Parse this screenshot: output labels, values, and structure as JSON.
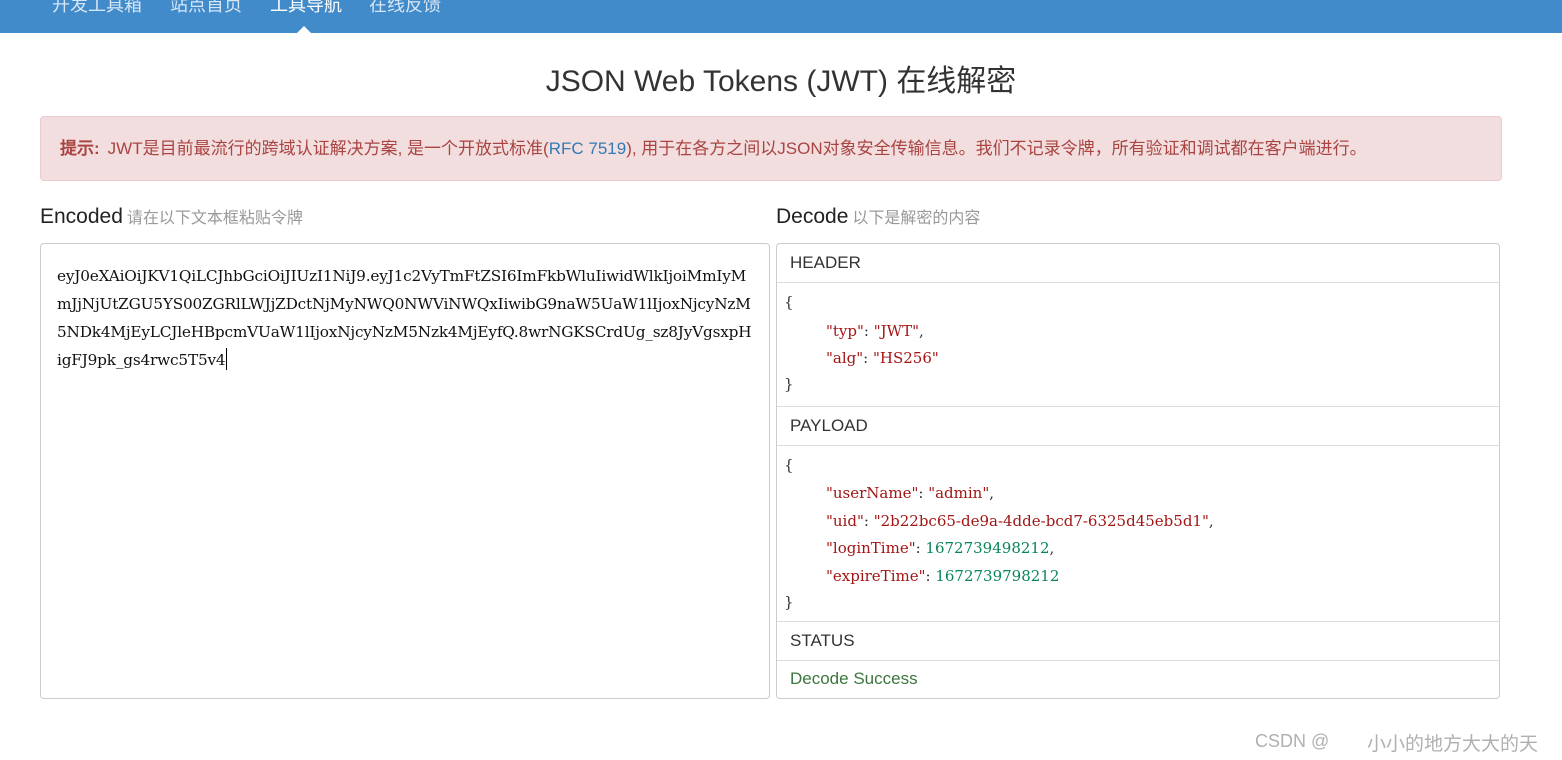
{
  "nav": {
    "items": [
      {
        "label": "开发工具箱"
      },
      {
        "label": "站点首页"
      },
      {
        "label": "工具导航"
      },
      {
        "label": "在线反馈"
      }
    ]
  },
  "page": {
    "title": "JSON Web Tokens (JWT) 在线解密"
  },
  "alert": {
    "label": "提示:",
    "text_before": "JWT是目前最流行的跨域认证解决方案, 是一个开放式标准(",
    "link": "RFC 7519",
    "text_after": "), 用于在各方之间以JSON对象安全传输信息。我们不记录令牌，所有验证和调试都在客户端进行。"
  },
  "encoded": {
    "heading": "Encoded",
    "sub": "请在以下文本框粘贴令牌",
    "token": "eyJ0eXAiOiJKV1QiLCJhbGciOiJIUzI1NiJ9.eyJ1c2VyTmFtZSI6ImFkbWluIiwidWlkIjoiMmIyMmJjNjUtZGU5YS00ZGRlLWJjZDctNjMyNWQ0NWViNWQxIiwibG9naW5UaW1lIjoxNjcyNzM5NDk4MjEyLCJleHBpcmVUaW1lIjoxNjcyNzM5Nzk4MjEyfQ.8wrNGKSCrdUg_sz8JyVgsxpHigFJ9pk_gs4rwc5T5v4"
  },
  "decode": {
    "heading": "Decode",
    "sub": "以下是解密的内容",
    "header_title": "HEADER",
    "header": {
      "typ": "JWT",
      "alg": "HS256"
    },
    "payload_title": "PAYLOAD",
    "payload": {
      "userName": "admin",
      "uid": "2b22bc65-de9a-4dde-bcd7-6325d45eb5d1",
      "loginTime": "1672739498212",
      "expireTime": "1672739798212"
    },
    "status_title": "STATUS",
    "status": "Decode Success"
  },
  "watermark": {
    "left": "CSDN @",
    "right": "小小的地方大大的天"
  }
}
